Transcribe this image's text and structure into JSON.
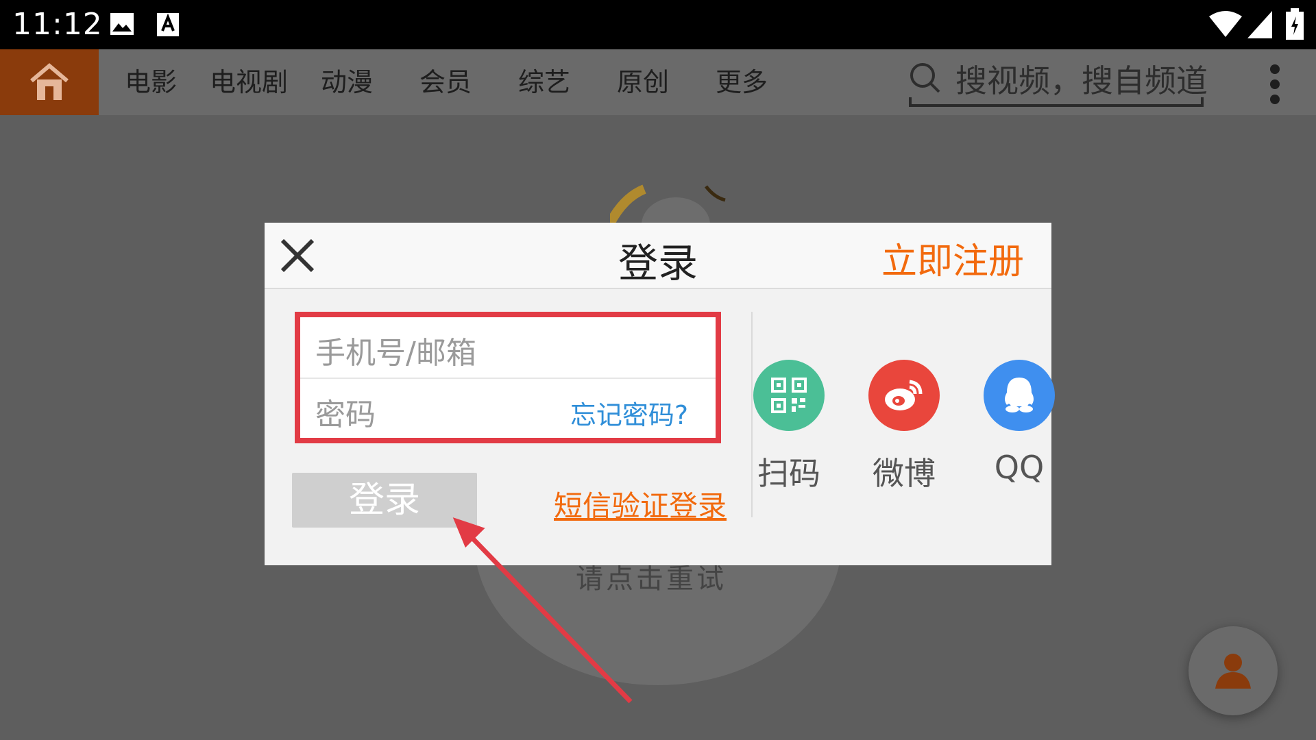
{
  "status_bar": {
    "time": "11:12"
  },
  "nav": {
    "items": [
      "电影",
      "电视剧",
      "动漫",
      "会员",
      "综艺",
      "原创",
      "更多"
    ],
    "search_placeholder": "搜视频，搜自频道"
  },
  "background": {
    "retry_text": "请点击重试"
  },
  "dialog": {
    "title": "登录",
    "register_link": "立即注册",
    "phone_placeholder": "手机号/邮箱",
    "password_placeholder": "密码",
    "forgot_password": "忘记密码?",
    "login_button": "登录",
    "sms_login": "短信验证登录",
    "social": [
      {
        "label": "扫码",
        "icon": "qr-code-icon",
        "color": "#4bbf96"
      },
      {
        "label": "微博",
        "icon": "weibo-icon",
        "color": "#e9463c"
      },
      {
        "label": "QQ",
        "icon": "qq-icon",
        "color": "#3f8fef"
      }
    ]
  },
  "colors": {
    "accent": "#f26a0e",
    "home": "#8a3b0c",
    "highlight": "#e23b45",
    "link": "#2f8ed8"
  }
}
